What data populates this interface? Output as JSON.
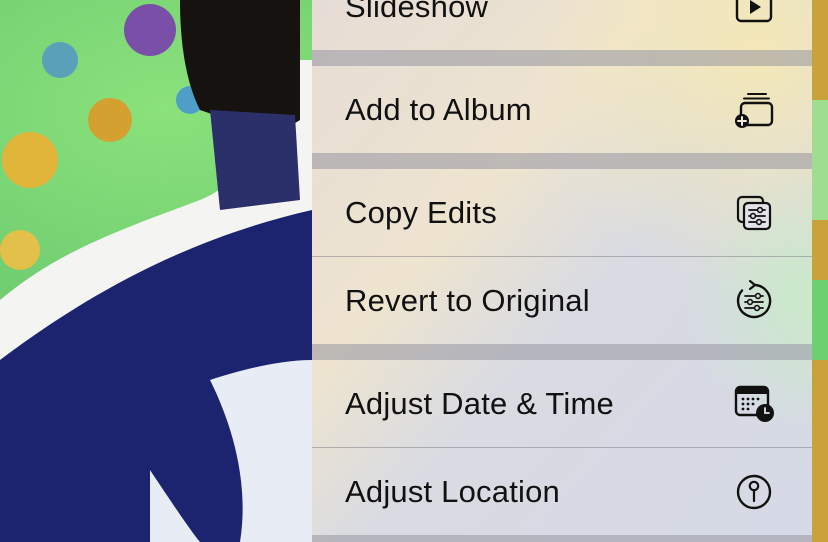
{
  "menu": {
    "items": [
      {
        "label": "Slideshow",
        "icon": "play-rectangle-icon"
      },
      {
        "label": "Add to Album",
        "icon": "add-to-album-icon"
      },
      {
        "label": "Copy Edits",
        "icon": "copy-edits-icon"
      },
      {
        "label": "Revert to Original",
        "icon": "revert-icon"
      },
      {
        "label": "Adjust Date & Time",
        "icon": "calendar-clock-icon"
      },
      {
        "label": "Adjust Location",
        "icon": "location-pin-icon"
      }
    ]
  },
  "colors": {
    "menu_tint_top": "#f3e6c8",
    "menu_tint_mid": "#d8dde8",
    "background_green": "#7fe07a",
    "shirt_navy": "#1c2470"
  }
}
